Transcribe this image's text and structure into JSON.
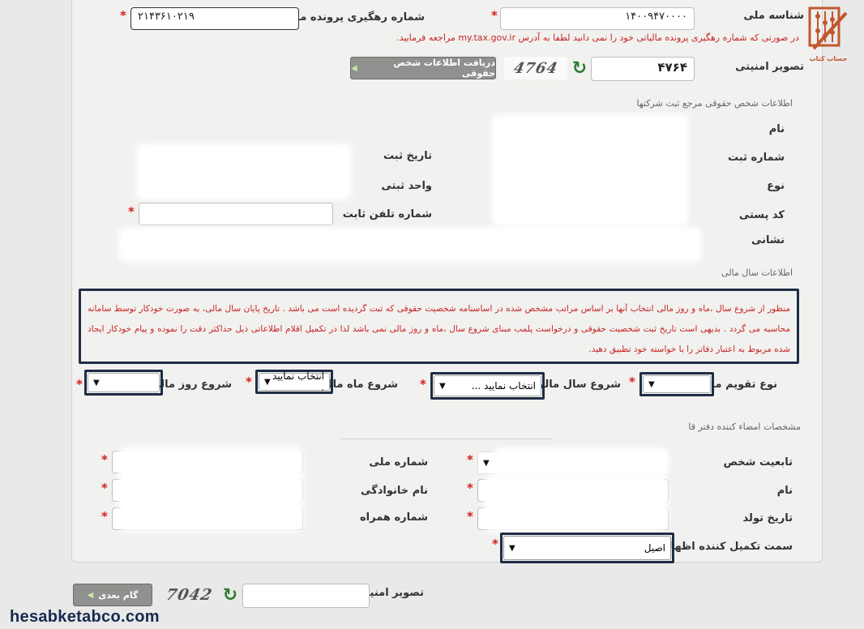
{
  "form": {
    "national_id": {
      "label": "شناسه ملی",
      "value": "۱۴۰۰۹۴۷۰۰۰۰"
    },
    "tax_tracking": {
      "label": "شماره رهگیری پرونده مالیاتی",
      "value": "۲۱۴۳۶۱۰۲۱۹"
    },
    "tax_notice": "در صورتی که شماره رهگیری پرونده مالیاتی خود را نمی دانید لطفا به آدرس my.tax.gov.ir مراجعه فرمایید.",
    "captcha": {
      "label": "تصویر امنیتی",
      "value": "۴۷۶۴",
      "image_text": "4764"
    },
    "fetch_button": "دریافت اطلاعات شخص حقوقی"
  },
  "legal_info": {
    "title": "اطلاعات شخص حقوقی مرجع ثبت شرکتها",
    "name": "نام",
    "reg_number": "شماره ثبت",
    "reg_date": "تاریخ ثبت",
    "type": "نوع",
    "reg_unit": "واحد ثبتی",
    "postal_code": "کد پستی",
    "phone": "شماره تلفن ثابت",
    "address": "نشانی"
  },
  "fiscal": {
    "title": "اطلاعات سال مالی",
    "notice": "منظور از شروع سال ،ماه و روز مالی انتخاب آنها بر اساس مراتب مشخص شده در اساسنامه شخصیت حقوقی که ثبت گردیده است می باشد . تاریخ پایان سال مالی، به صورت خودکار توسط سامانه محاسبه می گردد . بدیهی است تاریخ ثبت شخصیت حقوقی و درخواست پلمب مبنای شروع سال ،ماه و روز مالی نمی باشد لذا در تکمیل اقلام اطلاعاتی ذیل حداکثر دقت را نموده و پیام خودکار ایجاد شده مربوط به اعتبار دفاتر را با خواسته خود تطبیق دهید.",
    "calendar_type": "نوع تقویم مالی",
    "start_year": "شروع سال مالی",
    "start_year_value": "انتخاب نمایید ...",
    "start_month": "شروع ماه مالی",
    "start_month_value": "انتخاب نمایید .",
    "start_day": "شروع روز مالی"
  },
  "signer": {
    "title": "مشخصات امضاء کننده دفتر قا",
    "nationality": "تابعیت شخص",
    "national_code": "شماره ملی",
    "first_name": "نام",
    "last_name": "نام خانوادگی",
    "birth_date": "تاریخ تولد",
    "mobile": "شماره همراه",
    "role_label": "سمت تکمیل کننده اظهارنامه",
    "role_value": "اصیل"
  },
  "footer": {
    "captcha_label": "تصویر امنیتی",
    "captcha_image_text": "7042",
    "next_button": "گام بعدی"
  },
  "watermark": {
    "site": "hesabketabco.com",
    "logo_text": "حساب کتاب"
  },
  "colors": {
    "accent_red": "#d21f1f",
    "highlight_navy": "#1e2d46",
    "button_gray": "#8f918e"
  }
}
